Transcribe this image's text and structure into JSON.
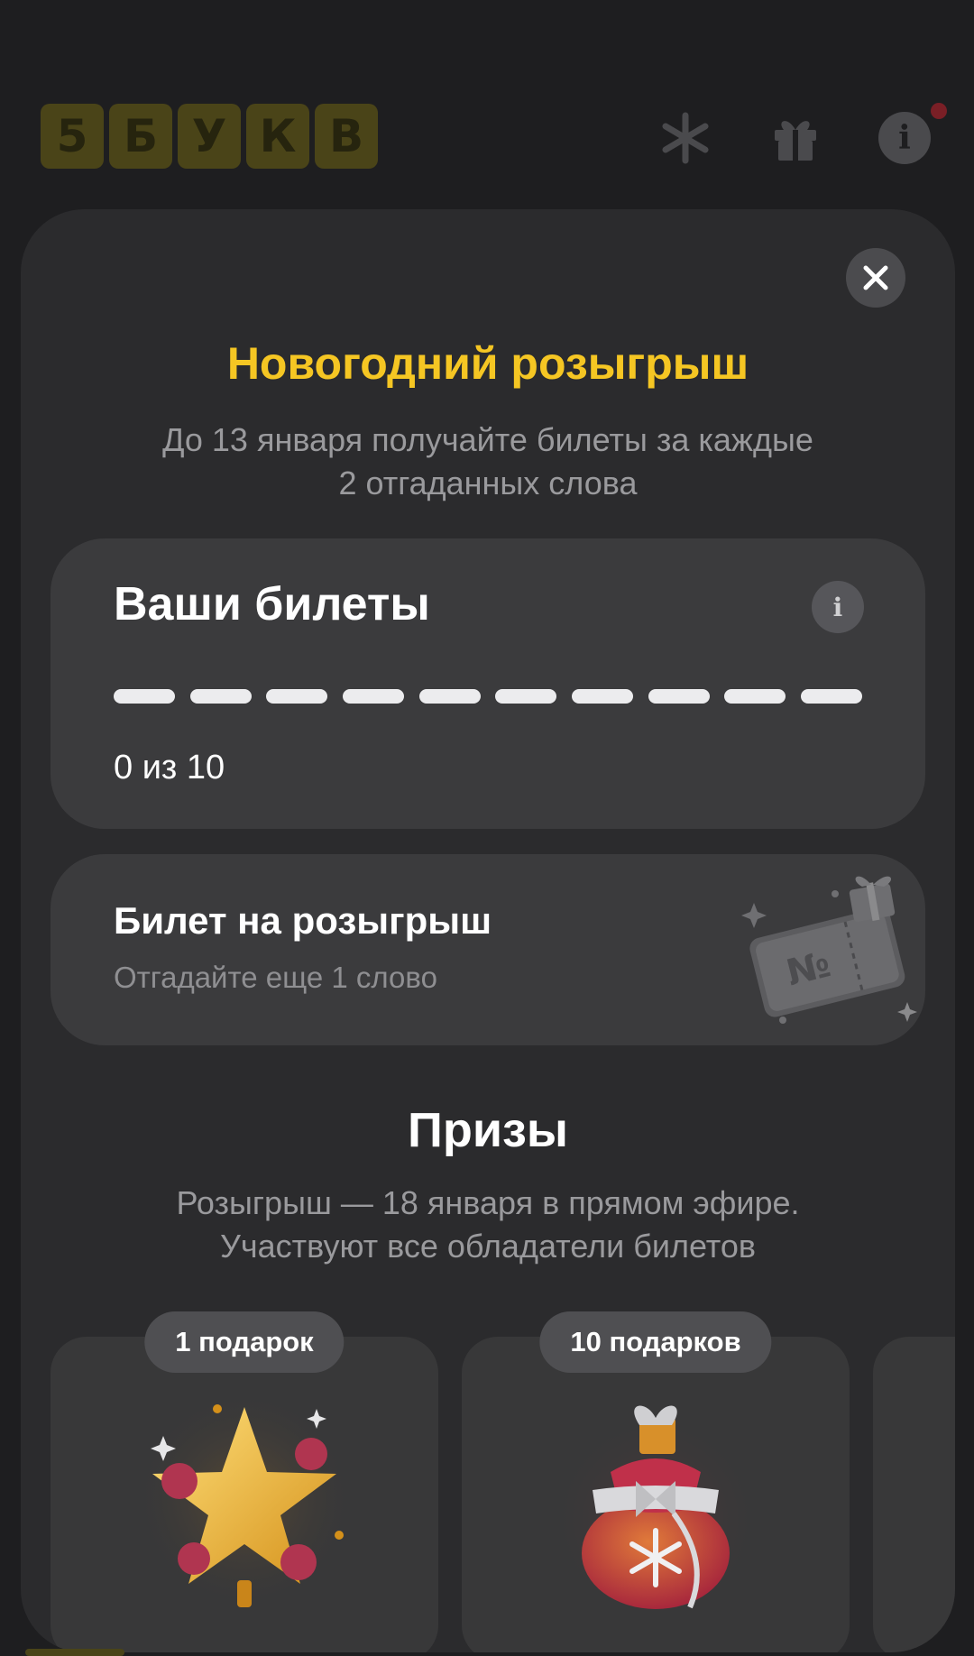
{
  "header": {
    "logo_letters": [
      "5",
      "Б",
      "У",
      "К",
      "В"
    ],
    "icons": [
      "snowflake-icon",
      "gift-icon",
      "info-icon"
    ],
    "info_glyph": "i"
  },
  "modal": {
    "close_glyph": "✕",
    "title": "Новогодний розыгрыш",
    "subtitle_line1": "До 13 января получайте билеты за каждые",
    "subtitle_line2": "2 отгаданных слова",
    "tickets": {
      "title": "Ваши билеты",
      "info_glyph": "i",
      "collected": 0,
      "total": 10,
      "count_text": "0 из 10"
    },
    "raffle": {
      "title": "Билет на розыгрыш",
      "subtitle": "Отгадайте еще 1 слово",
      "ticket_symbol": "№"
    },
    "prizes": {
      "title": "Призы",
      "subtitle_line1": "Розыгрыш — 18 января в прямом эфире.",
      "subtitle_line2": "Участвуют все обладатели билетов",
      "items": [
        {
          "badge": "1 подарок",
          "icon": "star-icon"
        },
        {
          "badge": "10 подарков",
          "icon": "gift-bag-icon"
        }
      ]
    }
  },
  "colors": {
    "accent": "#f5c623",
    "background": "#1e1e20",
    "modal": "#2b2b2d",
    "card": "#3b3b3d"
  }
}
